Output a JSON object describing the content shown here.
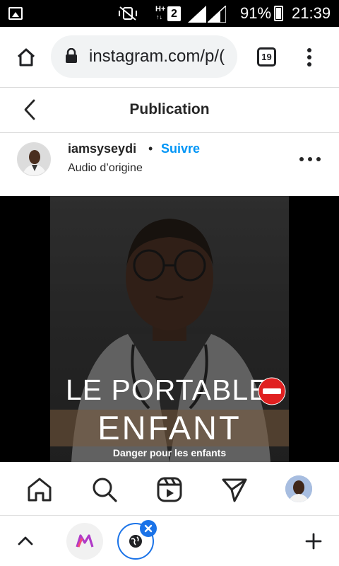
{
  "status_bar": {
    "network_type_top": "H+",
    "network_type_bottom": "↑↓",
    "sim_slot": "2",
    "battery_percent": "91%",
    "time": "21:39",
    "battery_level": 0.91
  },
  "browser": {
    "url": "instagram.com/p/(",
    "tab_count": "19"
  },
  "header": {
    "title": "Publication"
  },
  "post": {
    "username": "iamsyseydi",
    "separator": "•",
    "follow_label": "Suivre",
    "audio_label": "Audio d’origine",
    "media": {
      "title_line": "LE PORTABLE",
      "subtitle_line": "ENFANT",
      "caption": "Danger pour les enfants"
    }
  },
  "nav": {
    "items": [
      "home-icon",
      "search-icon",
      "reels-icon",
      "direct-message-icon",
      "profile-avatar"
    ]
  },
  "colors": {
    "accent_blue": "#0095f6",
    "text": "#262626",
    "no_entry_red": "#e02020"
  }
}
